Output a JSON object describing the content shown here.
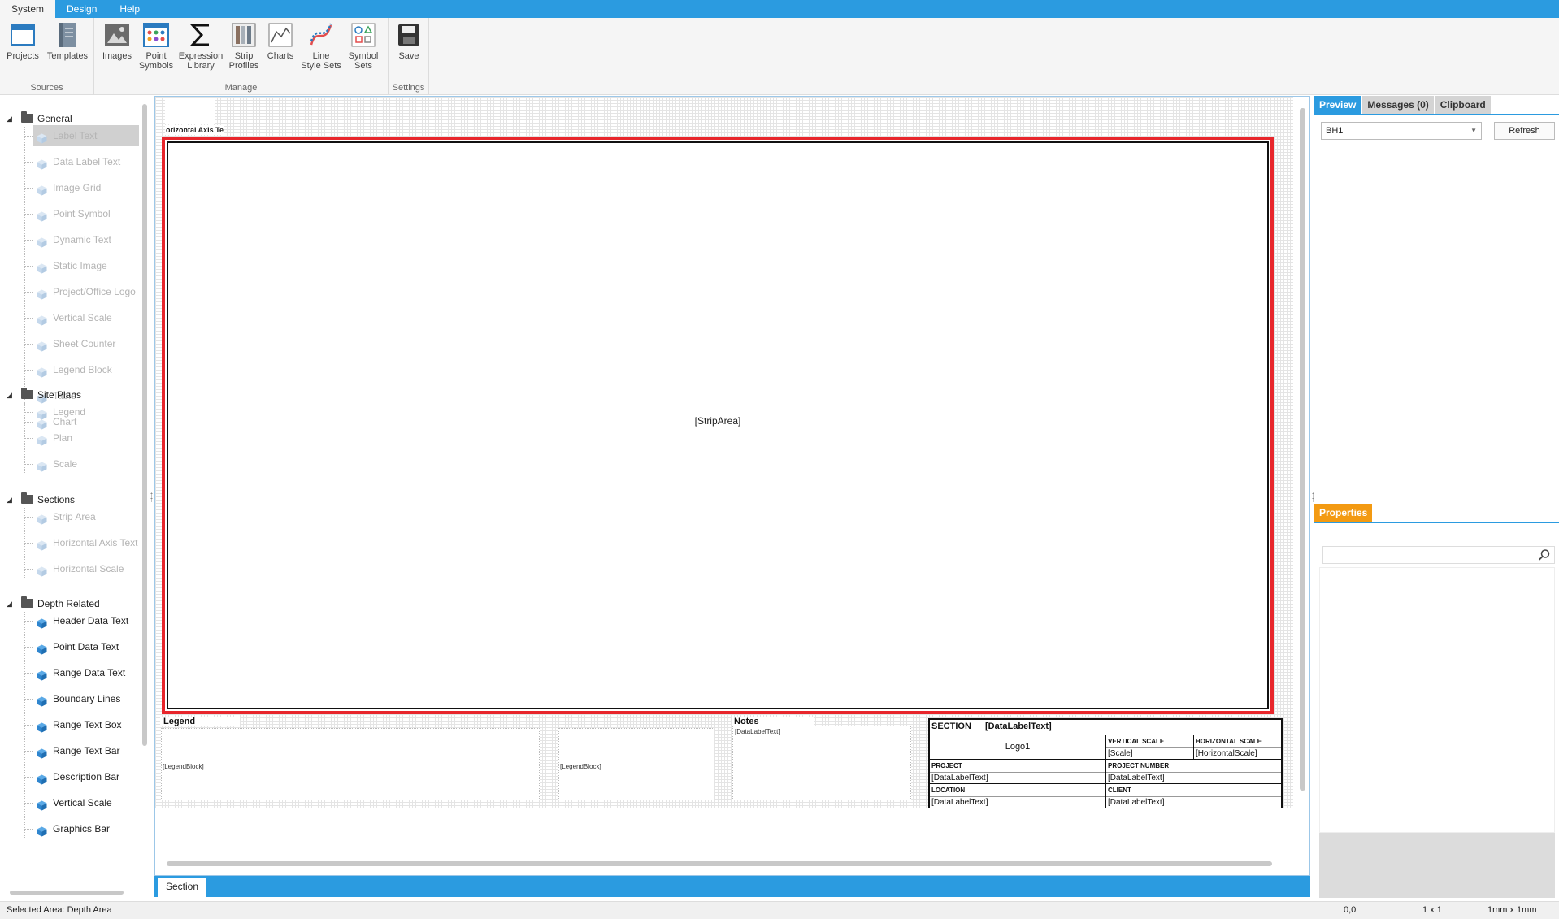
{
  "menu": {
    "items": [
      "System",
      "Design",
      "Help"
    ]
  },
  "ribbon": {
    "groups": {
      "sources": "Sources",
      "manage": "Manage",
      "settings": "Settings"
    },
    "buttons": {
      "projects": "Projects",
      "templates": "Templates",
      "images": "Images",
      "point_symbols_1": "Point",
      "point_symbols_2": "Symbols",
      "expression_1": "Expression",
      "expression_2": "Library",
      "strip_1": "Strip",
      "strip_2": "Profiles",
      "charts": "Charts",
      "line_style_1": "Line",
      "line_style_2": "Style Sets",
      "symbol_sets_1": "Symbol",
      "symbol_sets_2": "Sets",
      "save": "Save"
    }
  },
  "tree": {
    "general": {
      "label": "General",
      "items": [
        "Label Text",
        "Data Label Text",
        "Image Grid",
        "Point Symbol",
        "Dynamic Text",
        "Static Image",
        "Project/Office Logo",
        "Vertical Scale",
        "Sheet Counter",
        "Legend Block",
        "Table",
        "Chart"
      ]
    },
    "site_plans": {
      "label": "Site Plans",
      "items": [
        "Legend",
        "Plan",
        "Scale"
      ]
    },
    "sections": {
      "label": "Sections",
      "items": [
        "Strip Area",
        "Horizontal Axis Text",
        "Horizontal Scale"
      ]
    },
    "depth_related": {
      "label": "Depth Related",
      "items": [
        "Header Data Text",
        "Point Data Text",
        "Range Data Text",
        "Boundary Lines",
        "Range Text Box",
        "Range Text Bar",
        "Description Bar",
        "Vertical Scale",
        "Graphics Bar"
      ]
    }
  },
  "canvas": {
    "horizontal_axis_label": "orizontal Axis Te",
    "strip_area": "[StripArea]",
    "legend_title": "Legend",
    "legend_block_1": "[LegendBlock]",
    "legend_block_2": "[LegendBlock]",
    "notes_title": "Notes",
    "notes_text": "[DataLabelText]",
    "title_block": {
      "section_label": "SECTION",
      "section_value": "[DataLabelText]",
      "logo": "Logo1",
      "vertical_scale_label": "VERTICAL SCALE",
      "vertical_scale_value": "[Scale]",
      "horizontal_scale_label": "HORIZONTAL SCALE",
      "horizontal_scale_value": "[HorizontalScale]",
      "project_label": "PROJECT",
      "project_value": "[DataLabelText]",
      "project_number_label": "PROJECT NUMBER",
      "project_number_value": "[DataLabelText]",
      "location_label": "LOCATION",
      "location_value": "[DataLabelText]",
      "client_label": "CLIENT",
      "client_value": "[DataLabelText]"
    }
  },
  "sheet_tabs": {
    "active": "Section"
  },
  "right_panel": {
    "tabs": [
      "Preview",
      "Messages (0)",
      "Clipboard"
    ],
    "selected_borehole": "BH1",
    "refresh": "Refresh",
    "properties_tab": "Properties",
    "search_placeholder": ""
  },
  "status": {
    "text": "Selected Area: Depth Area",
    "coords": "0,0",
    "size": "1 x 1",
    "unit": "1mm x 1mm"
  },
  "colors": {
    "accent": "#2b9be0",
    "strip_border": "#e8262c",
    "properties_tab": "#f39a12",
    "tree_disabled": "#b4b4b4"
  }
}
